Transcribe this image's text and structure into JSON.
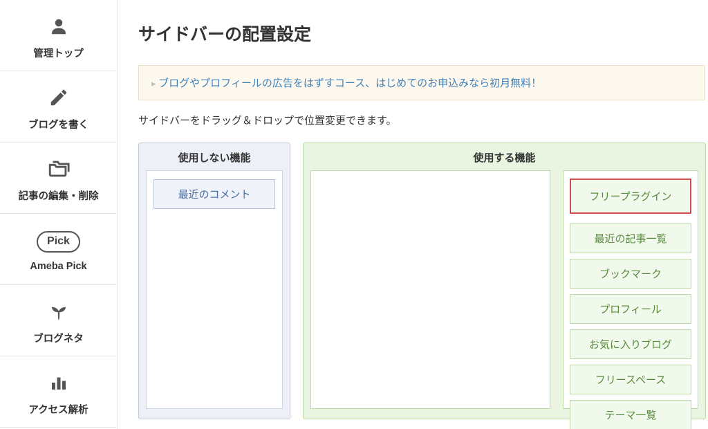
{
  "sidebar": {
    "items": [
      {
        "label": "管理トップ"
      },
      {
        "label": "ブログを書く"
      },
      {
        "label": "記事の編集・削除"
      },
      {
        "label": "Ameba Pick",
        "pick_text": "Pick"
      },
      {
        "label": "ブログネタ"
      },
      {
        "label": "アクセス解析"
      }
    ]
  },
  "page": {
    "title": "サイドバーの配置設定",
    "notice": "ブログやプロフィールの広告をはずすコース、はじめてのお申込みなら初月無料！",
    "description": "サイドバーをドラッグ＆ドロップで位置変更できます。"
  },
  "panels": {
    "unused": {
      "title": "使用しない機能",
      "items": [
        "最近のコメント"
      ]
    },
    "used": {
      "title": "使用する機能",
      "right_items": [
        {
          "label": "フリープラグイン",
          "highlight": true
        },
        {
          "label": "最近の記事一覧"
        },
        {
          "label": "ブックマーク"
        },
        {
          "label": "プロフィール"
        },
        {
          "label": "お気に入りブログ"
        },
        {
          "label": "フリースペース"
        },
        {
          "label": "テーマ一覧"
        }
      ]
    }
  }
}
